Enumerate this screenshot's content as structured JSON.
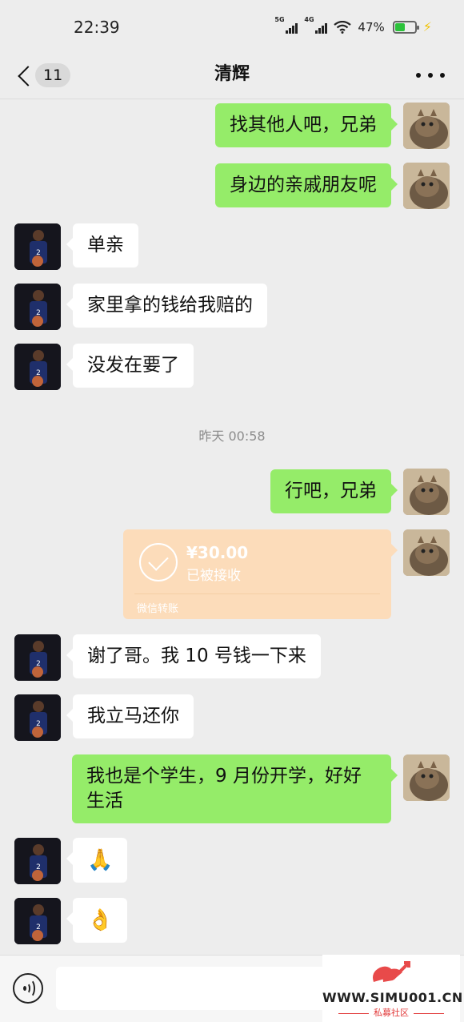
{
  "status_bar": {
    "time": "22:39",
    "net1": "5G",
    "net2": "4G",
    "battery": "47%",
    "battery_level": 0.47
  },
  "nav": {
    "back_count": "11",
    "title": "清辉",
    "more_icon": "more-dots-icon"
  },
  "messages": [
    {
      "side": "self",
      "text": "找其他人吧，兄弟"
    },
    {
      "side": "self",
      "text": "身边的亲戚朋友呢"
    },
    {
      "side": "friend",
      "text": "单亲"
    },
    {
      "side": "friend",
      "text": "家里拿的钱给我赔的"
    },
    {
      "side": "friend",
      "text": "没发在要了"
    },
    {
      "type": "time",
      "text": "昨天 00:58"
    },
    {
      "side": "self",
      "text": "行吧，兄弟"
    },
    {
      "side": "self",
      "type": "transfer",
      "amount": "¥30.00",
      "status": "已被接收",
      "label": "微信转账"
    },
    {
      "side": "friend",
      "text": "谢了哥。我 10 号钱一下来"
    },
    {
      "side": "friend",
      "text": "我立马还你"
    },
    {
      "side": "self",
      "text": "我也是个学生，9 月份开学，好好生活"
    },
    {
      "side": "friend",
      "text": "🙏"
    },
    {
      "side": "friend",
      "text": "👌"
    }
  ],
  "input_bar": {
    "voice_icon": "voice-icon"
  },
  "watermark": {
    "url": "WWW.SIMU001.CN",
    "sub": "私募社区"
  },
  "colors": {
    "self_bubble": "#95ec69",
    "friend_bubble": "#ffffff",
    "transfer_card": "#fcdcba",
    "background": "#ededed"
  }
}
